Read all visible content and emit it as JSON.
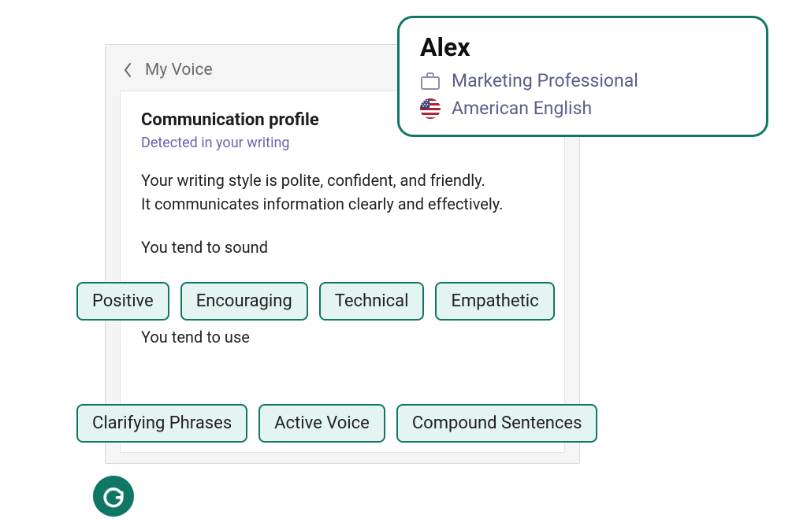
{
  "panel": {
    "title": "My Voice"
  },
  "communication": {
    "heading": "Communication profile",
    "subheading": "Detected in your writing",
    "description_line1": "Your writing style is polite, confident, and friendly.",
    "description_line2": "It communicates information clearly and effectively.",
    "sound_lead": "You tend to sound",
    "use_lead": "You tend to use",
    "sound_tags": [
      "Positive",
      "Encouraging",
      "Technical",
      "Empathetic"
    ],
    "use_tags": [
      "Clarifying Phrases",
      "Active Voice",
      "Compound Sentences"
    ]
  },
  "profile": {
    "name": "Alex",
    "role": "Marketing Professional",
    "language": "American English"
  }
}
